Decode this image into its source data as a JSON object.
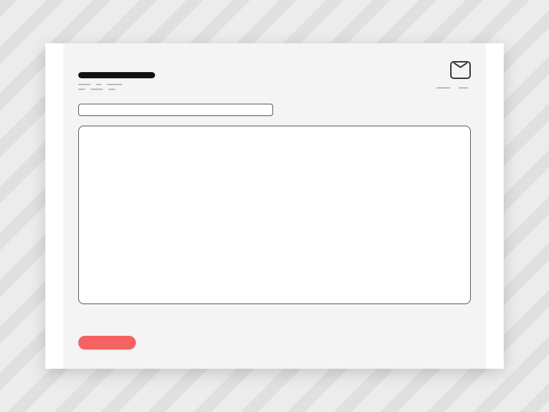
{
  "header": {
    "title": "",
    "meta_left": [
      "",
      "",
      "",
      "",
      "",
      ""
    ],
    "meta_right": [
      "",
      ""
    ]
  },
  "icons": {
    "mail": "mail-icon"
  },
  "compose": {
    "subject_value": "",
    "subject_placeholder": "",
    "body_value": "",
    "body_placeholder": ""
  },
  "actions": {
    "send_label": ""
  },
  "colors": {
    "accent": "#f56262",
    "card": "#f4f4f4",
    "background": "#ececec"
  }
}
